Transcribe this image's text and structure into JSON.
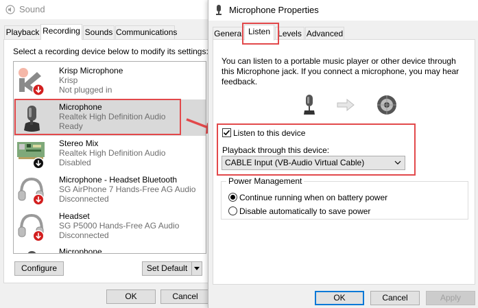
{
  "sound_window": {
    "title": "Sound",
    "tabs": [
      {
        "label": "Playback"
      },
      {
        "label": "Recording"
      },
      {
        "label": "Sounds"
      },
      {
        "label": "Communications"
      }
    ],
    "instruction": "Select a recording device below to modify its settings:",
    "devices": [
      {
        "name": "Krisp Microphone",
        "driver": "Krisp",
        "status": "Not plugged in",
        "icon": "krisp-logo-icon"
      },
      {
        "name": "Microphone",
        "driver": "Realtek High Definition Audio",
        "status": "Ready",
        "icon": "microphone-icon"
      },
      {
        "name": "Stereo Mix",
        "driver": "Realtek High Definition Audio",
        "status": "Disabled",
        "icon": "sound-card-icon"
      },
      {
        "name": "Microphone - Headset Bluetooth",
        "driver": "SG AirPhone 7 Hands-Free AG Audio",
        "status": "Disconnected",
        "icon": "headset-icon"
      },
      {
        "name": "Headset",
        "driver": "SG P5000 Hands-Free AG Audio",
        "status": "Disconnected",
        "icon": "headset-icon"
      },
      {
        "name": "Microphone",
        "driver": "",
        "status": "",
        "icon": "microphone-icon"
      }
    ],
    "buttons": {
      "configure": "Configure",
      "set_default": "Set Default",
      "ok": "OK",
      "cancel": "Cancel"
    }
  },
  "mic_window": {
    "title": "Microphone Properties",
    "tabs": [
      {
        "label": "General"
      },
      {
        "label": "Listen"
      },
      {
        "label": "Levels"
      },
      {
        "label": "Advanced"
      }
    ],
    "description": "You can listen to a portable music player or other device through this Microphone jack.  If you connect a microphone, you may hear feedback.",
    "listen_checkbox": {
      "label": "Listen to this device",
      "checked": true
    },
    "playback_label": "Playback through this device:",
    "playback_device": "CABLE Input (VB-Audio Virtual Cable)",
    "power_group": {
      "title": "Power Management",
      "options": [
        {
          "label": "Continue running when on battery power",
          "selected": true
        },
        {
          "label": "Disable automatically to save power",
          "selected": false
        }
      ]
    },
    "buttons": {
      "ok": "OK",
      "cancel": "Cancel",
      "apply": "Apply"
    }
  },
  "colors": {
    "highlight": "#e2484a",
    "selected_row": "#d9d9d9",
    "focus_border": "#0078d7"
  }
}
